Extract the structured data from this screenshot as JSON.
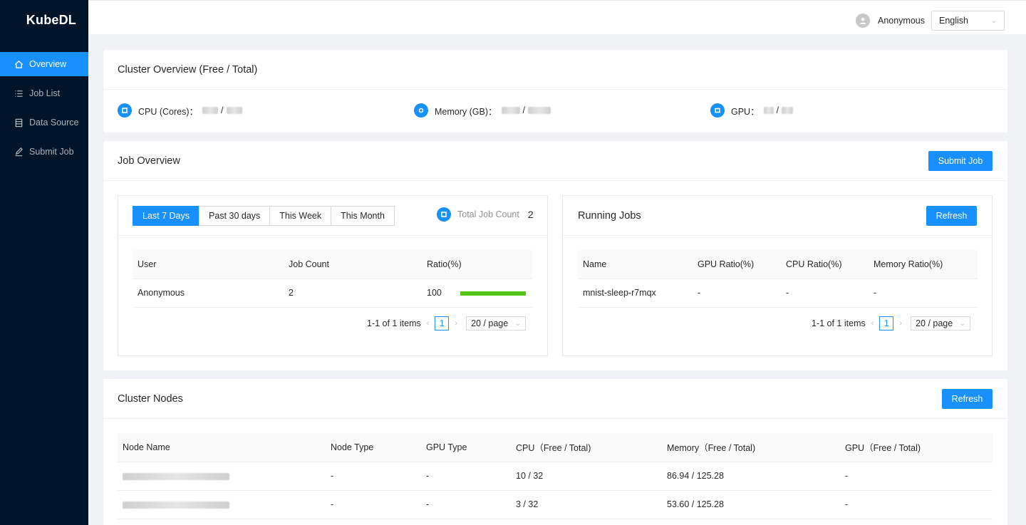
{
  "app": {
    "title": "KubeDL"
  },
  "sidebar": {
    "items": [
      {
        "label": "Overview",
        "icon": "home-icon",
        "active": true
      },
      {
        "label": "Job List",
        "icon": "list-icon",
        "active": false
      },
      {
        "label": "Data Source",
        "icon": "database-icon",
        "active": false
      },
      {
        "label": "Submit Job",
        "icon": "edit-icon",
        "active": false
      }
    ]
  },
  "header": {
    "username": "Anonymous",
    "language": "English"
  },
  "cluster_overview": {
    "title": "Cluster Overview (Free / Total)",
    "cpu_label": "CPU (Cores)：",
    "memory_label": "Memory (GB)：",
    "gpu_label": "GPU：",
    "separator": "/"
  },
  "job_overview": {
    "title": "Job Overview",
    "submit_label": "Submit Job",
    "ranges": [
      "Last 7 Days",
      "Past 30 days",
      "This Week",
      "This Month"
    ],
    "active_range": "Last 7 Days",
    "total_label": "Total Job Count",
    "total_value": "2",
    "table": {
      "columns": [
        "User",
        "Job Count",
        "Ratio(%)"
      ],
      "rows": [
        {
          "user": "Anonymous",
          "count": "2",
          "ratio": "100",
          "ratio_fraction": 1.0
        }
      ]
    },
    "pager": {
      "summary": "1-1 of 1 items",
      "page": "1",
      "size": "20 / page"
    }
  },
  "running_jobs": {
    "title": "Running Jobs",
    "refresh_label": "Refresh",
    "table": {
      "columns": [
        "Name",
        "GPU Ratio(%)",
        "CPU Ratio(%)",
        "Memory Ratio(%)"
      ],
      "rows": [
        {
          "name": "mnist-sleep-r7mqx",
          "gpu": "-",
          "cpu": "-",
          "memory": "-"
        }
      ]
    },
    "pager": {
      "summary": "1-1 of 1 items",
      "page": "1",
      "size": "20 / page"
    }
  },
  "cluster_nodes": {
    "title": "Cluster Nodes",
    "refresh_label": "Refresh",
    "table": {
      "columns": [
        "Node Name",
        "Node Type",
        "GPU Type",
        "CPU（Free / Total)",
        "Memory（Free / Total)",
        "GPU（Free / Total)"
      ],
      "rows": [
        {
          "node_type": "-",
          "gpu_type": "-",
          "cpu": "10 / 32",
          "memory": "86.94 / 125.28",
          "gpu": "-"
        },
        {
          "node_type": "-",
          "gpu_type": "-",
          "cpu": "3 / 32",
          "memory": "53.60 / 125.28",
          "gpu": "-"
        }
      ]
    }
  },
  "colors": {
    "primary": "#1890ff",
    "sidebar": "#001529",
    "success": "#52c41a"
  }
}
